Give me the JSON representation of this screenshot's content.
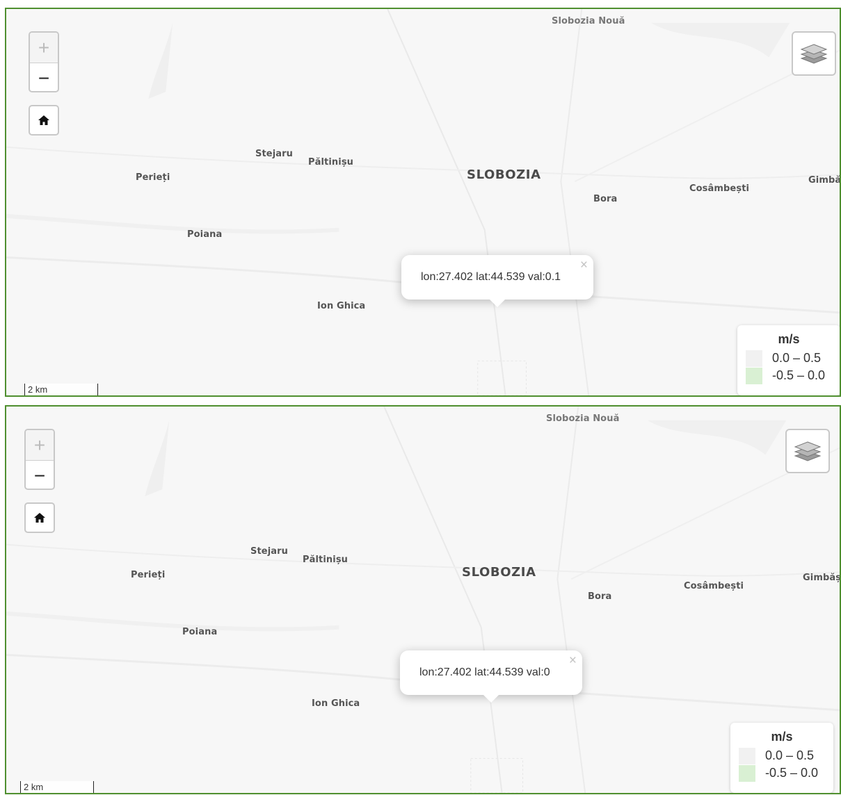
{
  "map": {
    "places": {
      "slobozia_noua": "Slobozia Nouă",
      "stejaru": "Stejaru",
      "paltinisu": "Păltinișu",
      "perieti": "Perieți",
      "slobozia": "SLOBOZIA",
      "bora": "Bora",
      "cosambesti": "Cosâmbești",
      "gimbasani": "Gimbășani",
      "poiana": "Poiana",
      "ion_ghica": "Ion Ghica"
    },
    "colors": {
      "frame_border": "#4f8f2f",
      "map_bg": "#f7f7f7",
      "legend_swatch_positive": "#f1f1f1",
      "legend_swatch_negative": "#d9f0d3"
    }
  },
  "panels": [
    {
      "zoom_in": "+",
      "zoom_out": "−",
      "popup": "lon:27.402 lat:44.539 val:0.1",
      "popup_close": "×",
      "legend": {
        "title": "m/s",
        "ranges": [
          "0.0 – 0.5",
          "-0.5 – 0.0"
        ]
      },
      "scale": "2 km"
    },
    {
      "zoom_in": "+",
      "zoom_out": "−",
      "popup": "lon:27.402 lat:44.539 val:0",
      "popup_close": "×",
      "legend": {
        "title": "m/s",
        "ranges": [
          "0.0 – 0.5",
          "-0.5 – 0.0"
        ]
      },
      "scale": "2 km"
    }
  ]
}
